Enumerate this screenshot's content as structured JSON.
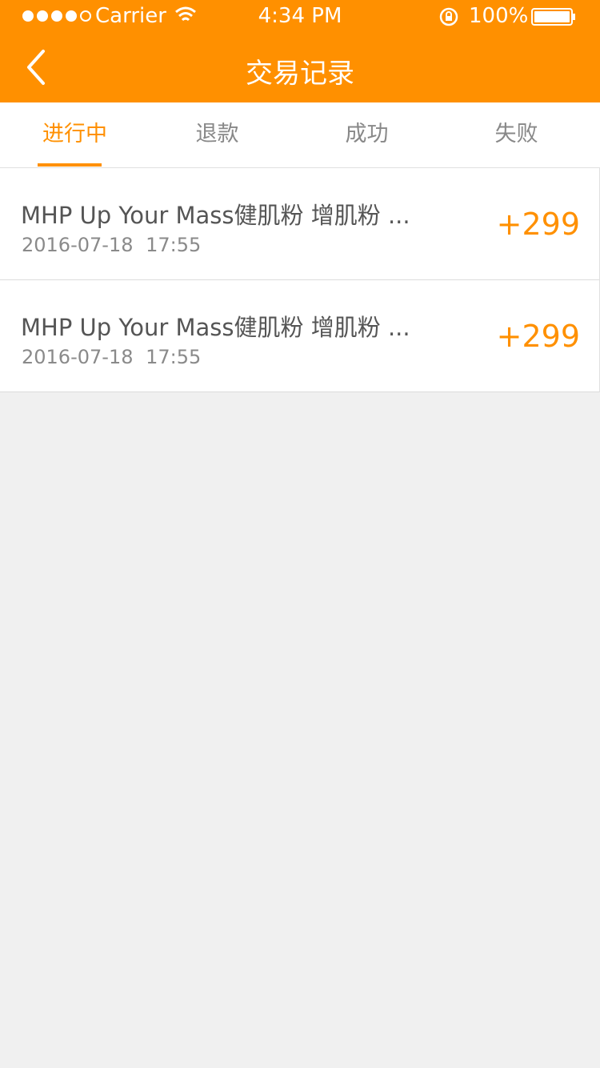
{
  "status_bar": {
    "carrier": "Carrier",
    "time": "4:34 PM",
    "battery": "100%"
  },
  "nav": {
    "title": "交易记录",
    "back_icon": "chevron-left-icon"
  },
  "tabs": [
    {
      "label": "进行中",
      "active": true
    },
    {
      "label": "退款",
      "active": false
    },
    {
      "label": "成功",
      "active": false
    },
    {
      "label": "失败",
      "active": false
    }
  ],
  "records": [
    {
      "title": "MHP Up Your Mass健肌粉 增肌粉 ...",
      "date": "2016-07-18 17:55",
      "amount": "+299"
    },
    {
      "title": "MHP Up Your Mass健肌粉 增肌粉 ...",
      "date": "2016-07-18 17:55",
      "amount": "+299"
    }
  ],
  "colors": {
    "accent": "#ff9000",
    "background": "#f0f0f0"
  }
}
